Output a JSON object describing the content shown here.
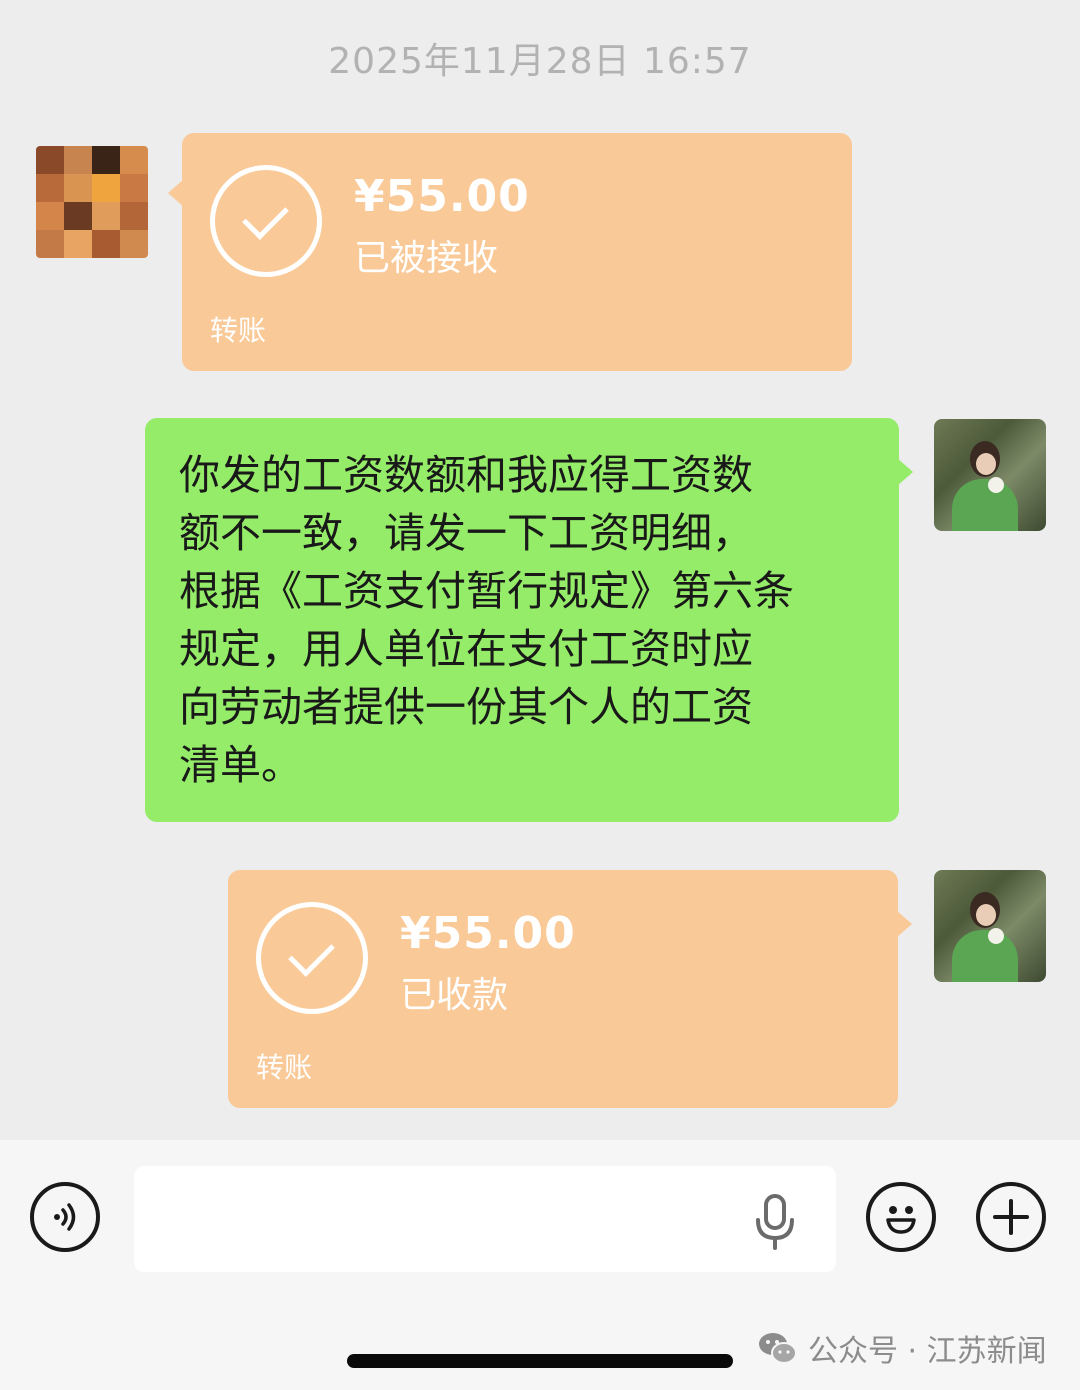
{
  "timestamp": "2025年11月28日 16:57",
  "messages": [
    {
      "type": "transfer",
      "side": "left",
      "amount": "¥55.00",
      "status": "已被接收",
      "footer": "转账"
    },
    {
      "type": "text",
      "side": "right",
      "lines": [
        "你发的工资数额和我应得工资数",
        "额不一致，请发一下工资明细，",
        "根据《工资支付暂行规定》第六条",
        "规定，用人单位在支付工资时应",
        "向劳动者提供一份其个人的工资",
        "清单。"
      ]
    },
    {
      "type": "transfer",
      "side": "right",
      "amount": "¥55.00",
      "status": "已收款",
      "footer": "转账"
    }
  ],
  "input_bar": {
    "placeholder": "",
    "icons": [
      "voice-icon",
      "microphone-icon",
      "emoji-icon",
      "plus-icon"
    ]
  },
  "watermark": {
    "text": "公众号 · 江苏新闻",
    "icon": "wechat-icon"
  },
  "colors": {
    "background": "#ededed",
    "transfer_card": "#f9c998",
    "text_bubble": "#95ec69",
    "input_bar": "#f6f6f6"
  }
}
